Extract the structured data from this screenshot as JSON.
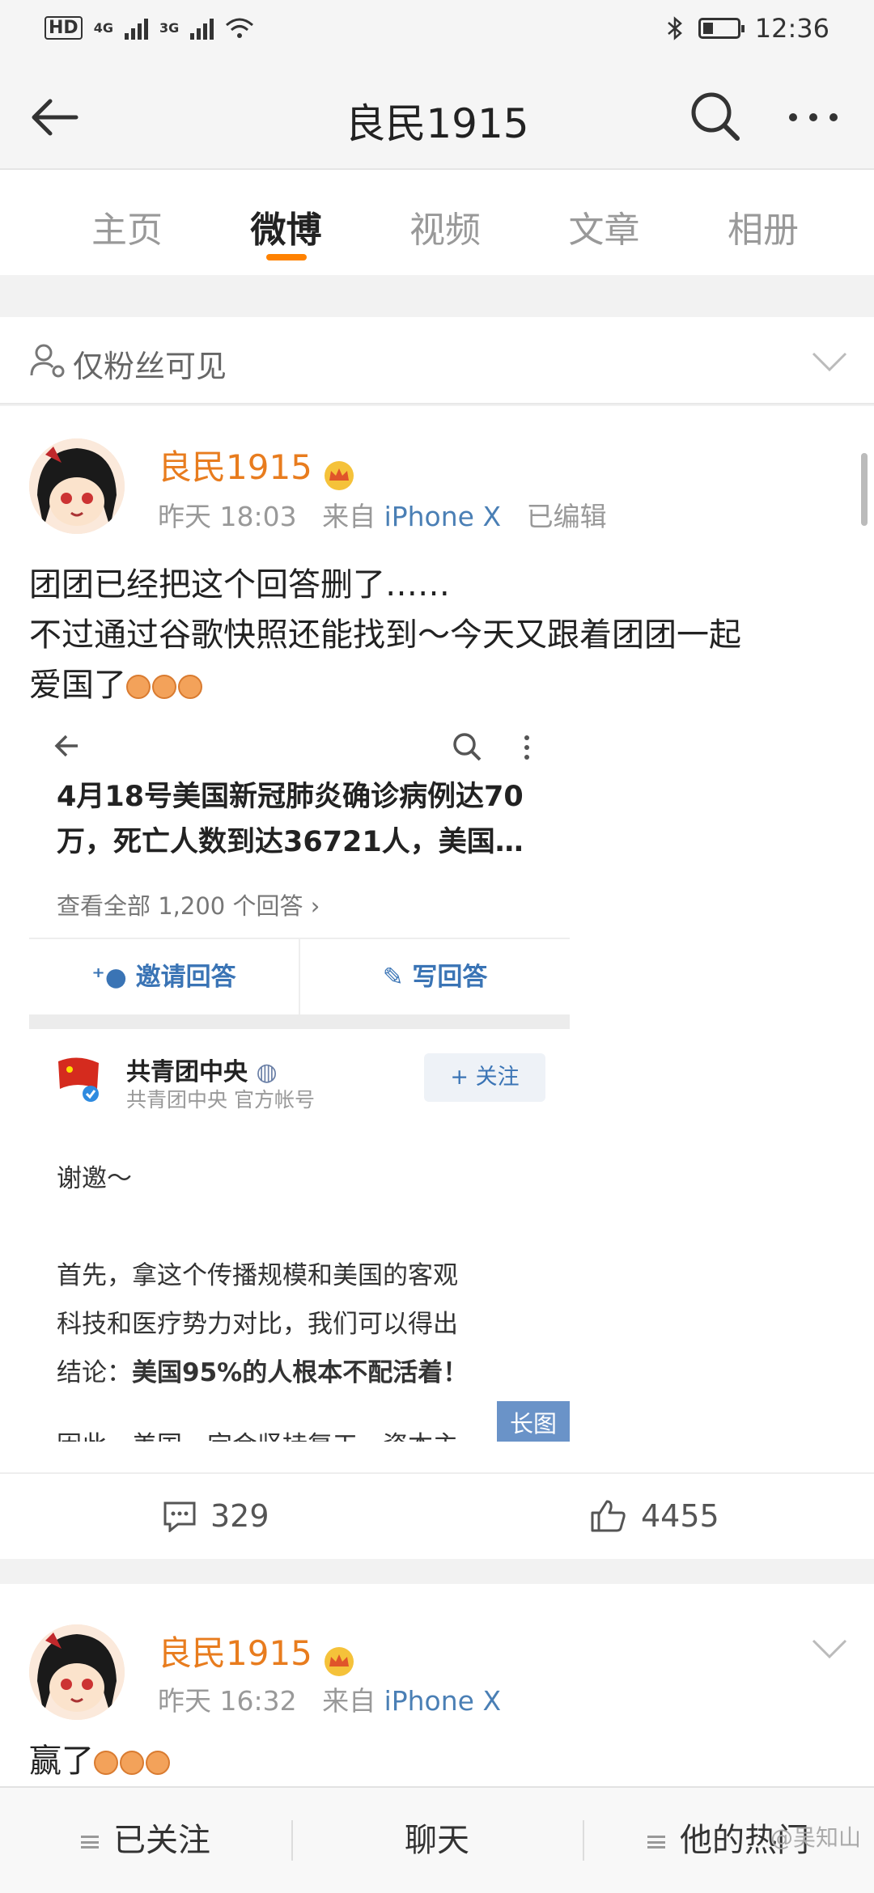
{
  "status_bar": {
    "left_indicators": [
      "HD",
      "4G",
      "3G"
    ],
    "time": "12:36"
  },
  "header": {
    "title": "良民1915",
    "icons": [
      "back-arrow-icon",
      "search-icon",
      "more-icon"
    ]
  },
  "tabs": [
    {
      "label": "主页",
      "active": false
    },
    {
      "label": "微博",
      "active": true
    },
    {
      "label": "视频",
      "active": false
    },
    {
      "label": "文章",
      "active": false
    },
    {
      "label": "相册",
      "active": false
    }
  ],
  "visibility": {
    "label": "仅粉丝可见"
  },
  "posts": [
    {
      "user": "良民1915",
      "time": "昨天 18:03",
      "source_prefix": "来自",
      "source": "iPhone X",
      "edited": "已编辑",
      "text_line1": "团团已经把这个回答删了……",
      "text_line2": "不过通过谷歌快照还能找到～今天又跟着团团一起",
      "text_line3": "爱国了",
      "embed": {
        "question_line1": "4月18号美国新冠肺炎确诊病例达70",
        "question_line2": "万，死亡人数到达36721人，美国…",
        "view_all": "查看全部 1,200 个回答",
        "invite": "邀请回答",
        "write": "写回答",
        "org_name": "共青团中央",
        "org_sub": "共青团中央 官方帐号",
        "follow": "+ 关注",
        "reply_thanks": "谢邀～",
        "para_line1": "首先，拿这个传播规模和美国的客观",
        "para_line2": "科技和医疗势力对比，我们可以得出",
        "para_line3_prefix": "结论：",
        "para_line3_bold": "美国95%的人根本不配活着！",
        "cutoff_line": "因此，美国一定会坚持复工，资本主",
        "long_image_badge": "长图"
      },
      "comments": "329",
      "likes": "4455"
    },
    {
      "user": "良民1915",
      "time": "昨天 16:32",
      "source_prefix": "来自",
      "source": "iPhone X",
      "text": "赢了"
    }
  ],
  "bottom_bar": {
    "following": "已关注",
    "chat": "聊天",
    "hot": "他的热门"
  },
  "watermark": "@吴知山",
  "colors": {
    "accent": "#ff8200",
    "username": "#e87c1e",
    "link": "#4a7fb5"
  }
}
